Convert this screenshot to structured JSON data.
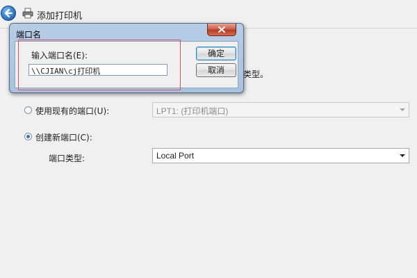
{
  "wizard": {
    "title": "添加打印机",
    "hidden_text_fragment": "类型。",
    "use_existing_port_label": "使用现有的端口(U):",
    "use_existing_port_value": "LPT1: (打印机端口)",
    "create_new_port_label": "创建新端口(C):",
    "port_type_label": "端口类型:",
    "port_type_value": "Local Port",
    "selected_option": "create_new_port"
  },
  "dialog": {
    "title": "端口名",
    "prompt": "输入端口名(E):",
    "port_name_value": "\\\\CJIAN\\cj打印机",
    "ok_label": "确定",
    "cancel_label": "取消"
  },
  "colors": {
    "background": "#f0f0f0",
    "dialog_frame": "#b7cde6",
    "close_button": "#c75a44",
    "highlight": "#e14f5a",
    "accent": "#3a6dbf"
  }
}
